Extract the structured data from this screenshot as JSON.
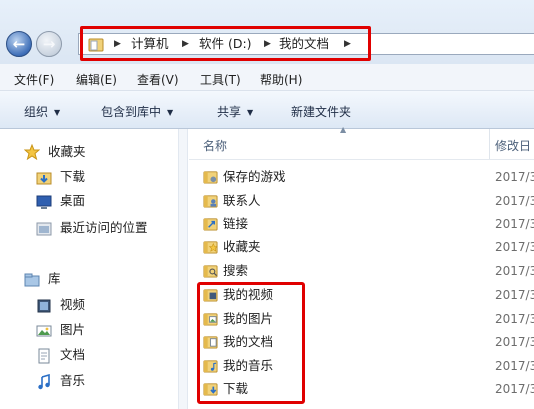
{
  "address_bar": {
    "crumbs": [
      "计算机",
      "软件 (D:)",
      "我的文档"
    ]
  },
  "menu": [
    "文件(F)",
    "编辑(E)",
    "查看(V)",
    "工具(T)",
    "帮助(H)"
  ],
  "toolbar": {
    "organize": "组织",
    "include_in_library": "包含到库中",
    "share": "共享",
    "new_folder": "新建文件夹"
  },
  "nav": {
    "favorites": "收藏夹",
    "downloads": "下载",
    "desktop": "桌面",
    "recent": "最近访问的位置",
    "libraries": "库",
    "videos": "视频",
    "pictures": "图片",
    "documents": "文档",
    "music": "音乐"
  },
  "columns": {
    "name": "名称",
    "modified": "修改日"
  },
  "files": [
    {
      "name": "保存的游戏",
      "date": "2017/3"
    },
    {
      "name": "联系人",
      "date": "2017/3"
    },
    {
      "name": "链接",
      "date": "2017/3"
    },
    {
      "name": "收藏夹",
      "date": "2017/3"
    },
    {
      "name": "搜索",
      "date": "2017/3"
    },
    {
      "name": "我的视频",
      "date": "2017/3"
    },
    {
      "name": "我的图片",
      "date": "2017/3"
    },
    {
      "name": "我的文档",
      "date": "2017/3"
    },
    {
      "name": "我的音乐",
      "date": "2017/3"
    },
    {
      "name": "下载",
      "date": "2017/3"
    }
  ],
  "colors": {
    "highlight": "#e00000",
    "accent": "#3f6fb8"
  }
}
